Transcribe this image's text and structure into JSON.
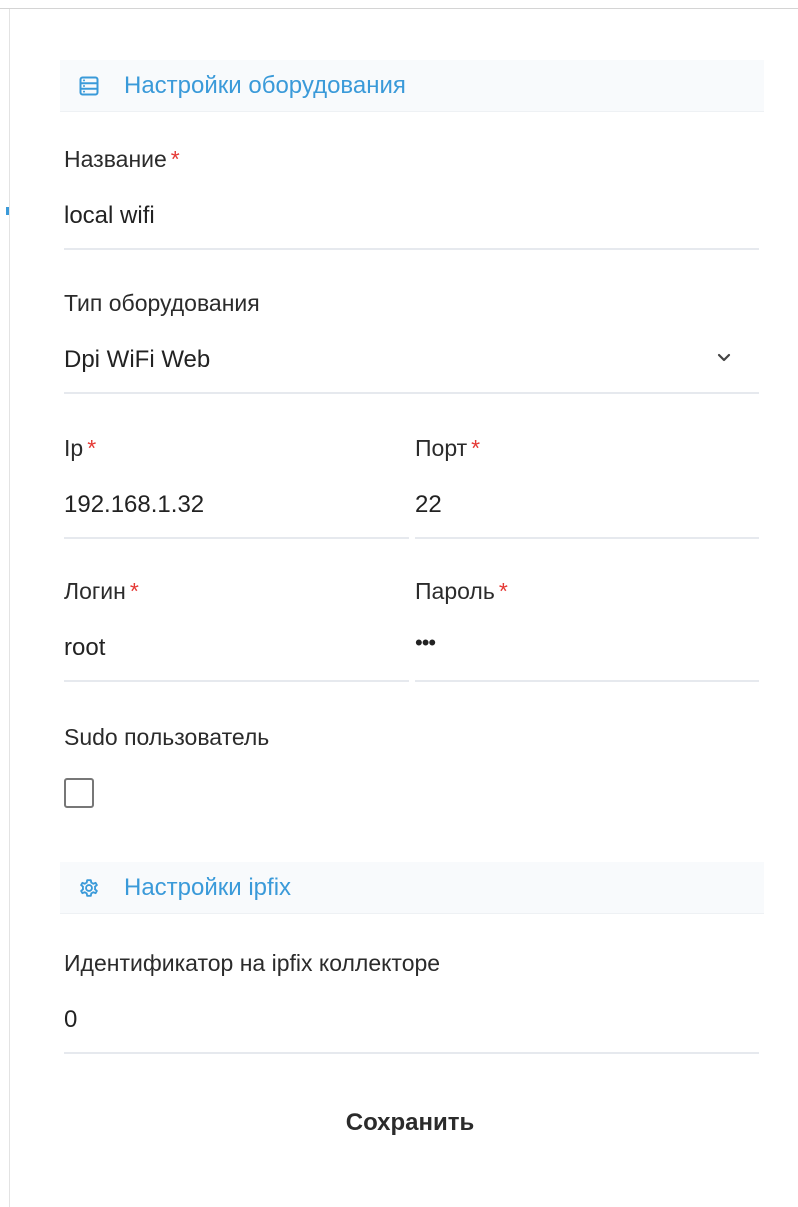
{
  "equipment_section": {
    "title": "Настройки оборудования",
    "icon": "server-icon"
  },
  "name_field": {
    "label": "Название",
    "required_mark": "*",
    "value": "local wifi"
  },
  "type_field": {
    "label": "Тип оборудования",
    "value": "Dpi WiFi Web",
    "icon": "chevron-down-icon"
  },
  "ip_field": {
    "label": "Ip",
    "required_mark": "*",
    "value": "192.168.1.32"
  },
  "port_field": {
    "label": "Порт",
    "required_mark": "*",
    "value": "22"
  },
  "login_field": {
    "label": "Логин",
    "required_mark": "*",
    "value": "root"
  },
  "password_field": {
    "label": "Пароль",
    "required_mark": "*",
    "value": "•••"
  },
  "sudo_field": {
    "label": "Sudo пользователь",
    "checked": false
  },
  "ipfix_section": {
    "title": "Настройки ipfix",
    "icon": "gear-icon"
  },
  "collector_id_field": {
    "label": "Идентификатор на ipfix коллекторе",
    "value": "0"
  },
  "actions": {
    "save_label": "Сохранить"
  },
  "colors": {
    "accent": "#3a9ad9",
    "required": "#e53935",
    "underline": "#e6e9ee",
    "section_bg": "#f8fafc"
  }
}
